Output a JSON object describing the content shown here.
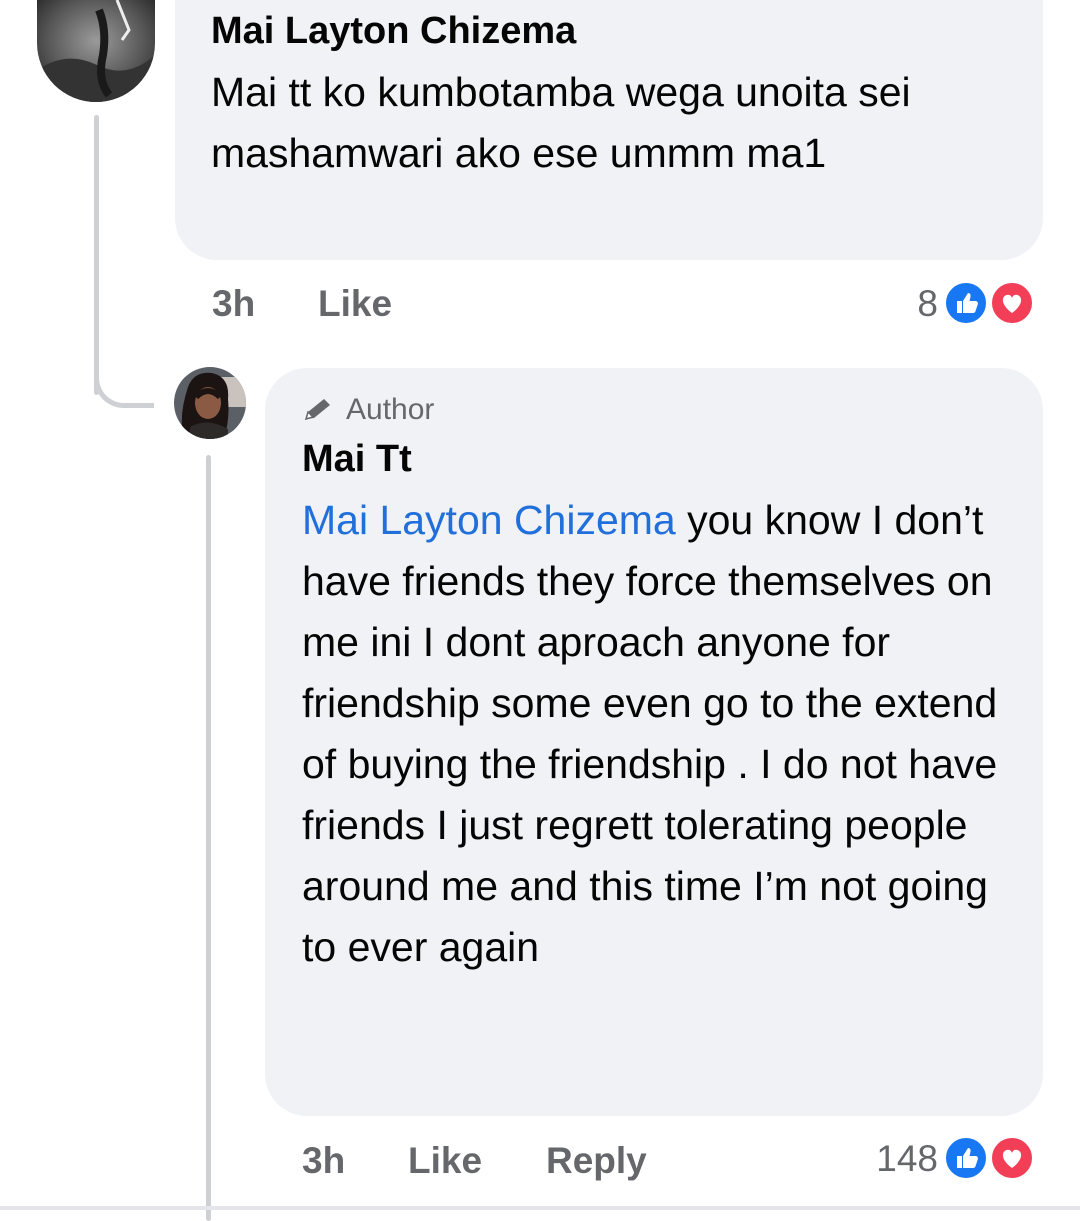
{
  "comments": [
    {
      "author": "Mai Layton Chizema",
      "text": "Mai tt  ko kumbotamba  wega unoita sei mashamwari  ako ese ummm ma1",
      "time": "3h",
      "like_label": "Like",
      "reaction_count": "8",
      "reactions": [
        "like-icon",
        "love-icon"
      ]
    },
    {
      "badge": "Author",
      "badge_icon": "pencil-icon",
      "author": "Mai Tt",
      "mention": "Mai Layton Chizema",
      "text": " you know I don’t have friends they force themselves on me ini I dont aproach anyone for friendship some even go to the extend of buying the friendship . I do not have friends I just regrett tolerating people around me and this time I’m not going to ever again",
      "time": "3h",
      "like_label": "Like",
      "reply_label": "Reply",
      "reaction_count": "148",
      "reactions": [
        "like-icon",
        "love-icon"
      ]
    }
  ],
  "colors": {
    "bubble": "#f0f2f5",
    "mention": "#216fdb",
    "meta": "#65676b",
    "like": "#1877f2",
    "love": "#f33e58"
  }
}
